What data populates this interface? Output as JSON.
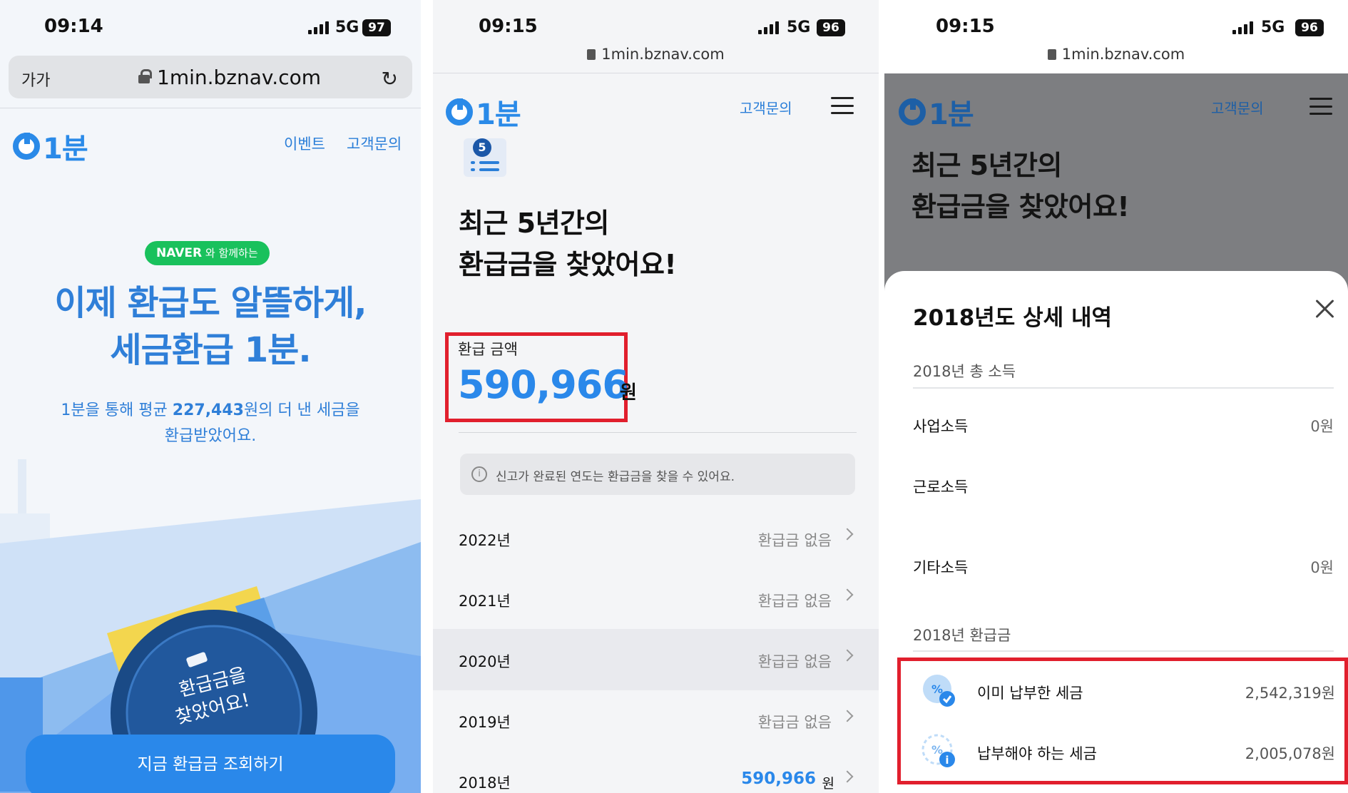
{
  "screen1": {
    "status": {
      "time": "09:14",
      "network": "5G",
      "battery": "97"
    },
    "browser": {
      "text_size": "가가",
      "domain": "1min.bznav.com",
      "reload_icon": "reload-icon"
    },
    "header": {
      "logo": "1분",
      "nav": [
        "이벤트",
        "고객문의"
      ]
    },
    "badge": {
      "brand": "NAVER",
      "text": "와 함께하는"
    },
    "hero": {
      "line1": "이제 환급도 알뜰하게,",
      "line2": "세금환급 1분."
    },
    "subtext": {
      "prefix": "1분을 통해 평균 ",
      "amount": "227,443",
      "suffix": "원의 더 낸 세금을",
      "line2": "환급받았어요."
    },
    "illustration": {
      "line1": "환급금을",
      "line2": "찾았어요!"
    },
    "cta": "지금 환급금 조회하기"
  },
  "screen2": {
    "status": {
      "time": "09:15",
      "network": "5G",
      "battery": "96"
    },
    "url": "1min.bznav.com",
    "header": {
      "logo": "1분",
      "inquiry": "고객문의"
    },
    "list_badge": "5",
    "title": {
      "line1": "최근 5년간의",
      "line2": "환급금을 찾았어요!"
    },
    "refund": {
      "label": "환급 금액",
      "amount": "590,966",
      "unit": "원"
    },
    "notice": "신고가 완료된 연도는 환급금을 찾을 수 있어요.",
    "years": [
      {
        "year": "2022년",
        "value": "환급금 없음"
      },
      {
        "year": "2021년",
        "value": "환급금 없음"
      },
      {
        "year": "2020년",
        "value": "환급금 없음"
      },
      {
        "year": "2019년",
        "value": "환급금 없음"
      },
      {
        "year": "2018년",
        "value": "590,966",
        "unit": "원"
      }
    ]
  },
  "screen3": {
    "status": {
      "time": "09:15",
      "network": "5G",
      "battery": "96"
    },
    "url": "1min.bznav.com",
    "header": {
      "logo": "1분",
      "inquiry": "고객문의"
    },
    "title": {
      "line1": "최근 5년간의",
      "line2": "환급금을 찾았어요!"
    },
    "sheet": {
      "title": "2018년도 상세 내역",
      "income_section": "2018년 총 소득",
      "incomes": [
        {
          "label": "사업소득",
          "value": "0원"
        },
        {
          "label": "근로소득",
          "value": ""
        },
        {
          "label": "기타소득",
          "value": "0원"
        }
      ],
      "refund_section": "2018년 환급금",
      "taxes": [
        {
          "label": "이미 납부한 세금",
          "value": "2,542,319원"
        },
        {
          "label": "납부해야 하는 세금",
          "value": "2,005,078원"
        }
      ]
    }
  },
  "colors": {
    "accent": "#2a88ea",
    "highlight": "#e11f2d",
    "naver": "#19c15c"
  }
}
